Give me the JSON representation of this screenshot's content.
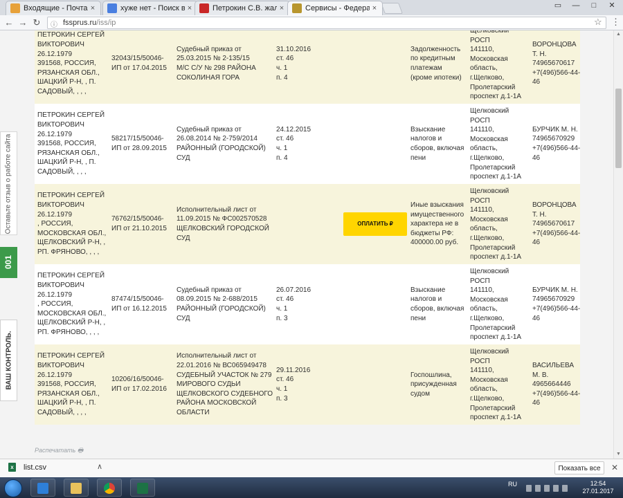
{
  "browser": {
    "tabs": [
      {
        "title": "Входящие - Почта Mail.",
        "icon_color": "#e7a13a",
        "icon": "mail-icon"
      },
      {
        "title": "хуже нет - Поиск в Goo",
        "icon_color": "#4a7fe0",
        "icon": "google-icon"
      },
      {
        "title": "Петрокин С.В. жалобы",
        "icon_color": "#c92727",
        "icon": "xi-icon"
      },
      {
        "title": "Сервисы - Федеральна",
        "icon_color": "#b8962e",
        "icon": "emblem-icon"
      }
    ],
    "url_host": "fssprus.ru",
    "url_path": "/iss/ip"
  },
  "table": {
    "pay_label": "ОПЛАТИТЬ ₽",
    "rows": [
      {
        "debtor": [
          "ПЕТРОКИН СЕРГЕЙ",
          "ВИКТОРОВИЧ",
          "26.12.1979",
          "391568, РОССИЯ,",
          "РЯЗАНСКАЯ ОБЛ.,",
          "ШАЦКИЙ Р-Н, , П.",
          "САДОВЫЙ, , , ,"
        ],
        "proc": [
          "32043/15/50046-",
          "ИП от 17.04.2015"
        ],
        "doc": [
          "Судебный приказ от",
          "25.03.2015 № 2-135/15",
          "М/С С/У № 298 РАЙОНА",
          "СОКОЛИНАЯ ГОРА"
        ],
        "end": [
          "31.10.2016",
          "ст. 46",
          "ч. 1",
          "п. 4"
        ],
        "subject": [
          "Задолженность",
          "по кредитным",
          "платежам",
          "(кроме ипотеки)"
        ],
        "dept": [
          "Щелковский",
          "РОСП",
          "141110,",
          "Московская",
          "область,",
          "г.Щелково,",
          "Пролетарский",
          "проспект д.1-1А"
        ],
        "bailiff": [
          "ВОРОНЦОВА",
          "Т. Н.",
          "74965670617",
          "+7(496)566-44-",
          "46"
        ],
        "pay": false
      },
      {
        "debtor": [
          "ПЕТРОКИН СЕРГЕЙ",
          "ВИКТОРОВИЧ",
          "26.12.1979",
          "391568, РОССИЯ,",
          "РЯЗАНСКАЯ ОБЛ.,",
          "ШАЦКИЙ Р-Н, , П.",
          "САДОВЫЙ, , , ,"
        ],
        "proc": [
          "58217/15/50046-",
          "ИП от 28.09.2015"
        ],
        "doc": [
          "Судебный приказ от",
          "26.08.2014 № 2-759/2014",
          "РАЙОННЫЙ (ГОРОДСКОЙ)",
          "СУД"
        ],
        "end": [
          "24.12.2015",
          "ст. 46",
          "ч. 1",
          "п. 4"
        ],
        "subject": [
          "Взыскание",
          "налогов и",
          "сборов, включая",
          "пени"
        ],
        "dept": [
          "Щелковский",
          "РОСП",
          "141110,",
          "Московская",
          "область,",
          "г.Щелково,",
          "Пролетарский",
          "проспект д.1-1А"
        ],
        "bailiff": [
          "БУРЧИК М. Н.",
          "74965670929",
          "+7(496)566-44-",
          "46"
        ],
        "pay": false
      },
      {
        "debtor": [
          "ПЕТРОКИН СЕРГЕЙ",
          "ВИКТОРОВИЧ",
          "26.12.1979",
          ", РОССИЯ,",
          "МОСКОВСКАЯ ОБЛ.,",
          "ЩЕЛКОВСКИЙ Р-Н, ,",
          "РП. ФРЯНОВО, , , ,"
        ],
        "proc": [
          "76762/15/50046-",
          "ИП от 21.10.2015"
        ],
        "doc": [
          "Исполнительный лист от",
          "11.09.2015 № ФС002570528",
          "ЩЕЛКОВСКИЙ ГОРОДСКОЙ",
          "СУД"
        ],
        "end": [],
        "subject": [
          "Иные взыскания",
          "имущественного",
          "характера не в",
          "бюджеты РФ:",
          "400000.00 руб."
        ],
        "dept": [
          "Щелковский",
          "РОСП",
          "141110,",
          "Московская",
          "область,",
          "г.Щелково,",
          "Пролетарский",
          "проспект д.1-1А"
        ],
        "bailiff": [
          "ВОРОНЦОВА",
          "Т. Н.",
          "74965670617",
          "+7(496)566-44-",
          "46"
        ],
        "pay": true
      },
      {
        "debtor": [
          "ПЕТРОКИН СЕРГЕЙ",
          "ВИКТОРОВИЧ",
          "26.12.1979",
          ", РОССИЯ,",
          "МОСКОВСКАЯ ОБЛ.,",
          "ЩЕЛКОВСКИЙ Р-Н, ,",
          "РП. ФРЯНОВО, , , ,"
        ],
        "proc": [
          "87474/15/50046-",
          "ИП от 16.12.2015"
        ],
        "doc": [
          "Судебный приказ от",
          "08.09.2015 № 2-688/2015",
          "РАЙОННЫЙ (ГОРОДСКОЙ)",
          "СУД"
        ],
        "end": [
          "26.07.2016",
          "ст. 46",
          "ч. 1",
          "п. 3"
        ],
        "subject": [
          "Взыскание",
          "налогов и",
          "сборов, включая",
          "пени"
        ],
        "dept": [
          "Щелковский",
          "РОСП",
          "141110,",
          "Московская",
          "область,",
          "г.Щелково,",
          "Пролетарский",
          "проспект д.1-1А"
        ],
        "bailiff": [
          "БУРЧИК М. Н.",
          "74965670929",
          "+7(496)566-44-",
          "46"
        ],
        "pay": false
      },
      {
        "debtor": [
          "ПЕТРОКИН СЕРГЕЙ",
          "ВИКТОРОВИЧ",
          "26.12.1979",
          "391568, РОССИЯ,",
          "РЯЗАНСКАЯ ОБЛ.,",
          "ШАЦКИЙ Р-Н, , П.",
          "САДОВЫЙ, , , ,"
        ],
        "proc": [
          "10206/16/50046-",
          "ИП от 17.02.2016"
        ],
        "doc": [
          "Исполнительный лист от",
          "22.01.2016 № ВС065949478",
          "СУДЕБНЫЙ УЧАСТОК № 279",
          "МИРОВОГО СУДЬИ",
          "ЩЕЛКОВСКОГО СУДЕБНОГО",
          "РАЙОНА МОСКОВСКОЙ",
          "ОБЛАСТИ"
        ],
        "end": [
          "29.11.2016",
          "ст. 46",
          "ч. 1",
          "п. 3"
        ],
        "subject": [
          "Госпошлина,",
          "присужденная",
          "судом"
        ],
        "dept": [
          "Щелковский",
          "РОСП",
          "141110,",
          "Московская",
          "область,",
          "г.Щелково,",
          "Пролетарский",
          "проспект д.1-1А"
        ],
        "bailiff": [
          "ВАСИЛЬЕВА",
          "М. В.",
          "4965664446",
          "+7(496)566-44-",
          "46"
        ]
      }
    ]
  },
  "page": {
    "print_link": "Распечатать 🖶",
    "feedback": "Оставьте отзыв о работе сайта",
    "green_label": "001",
    "vash_kontrol": "ВАШ КОНТРОЛЬ."
  },
  "downloads": {
    "file": "list.csv",
    "show_all": "Показать все"
  },
  "taskbar": {
    "lang": "RU",
    "time": "12:54",
    "date": "27.01.2017"
  }
}
